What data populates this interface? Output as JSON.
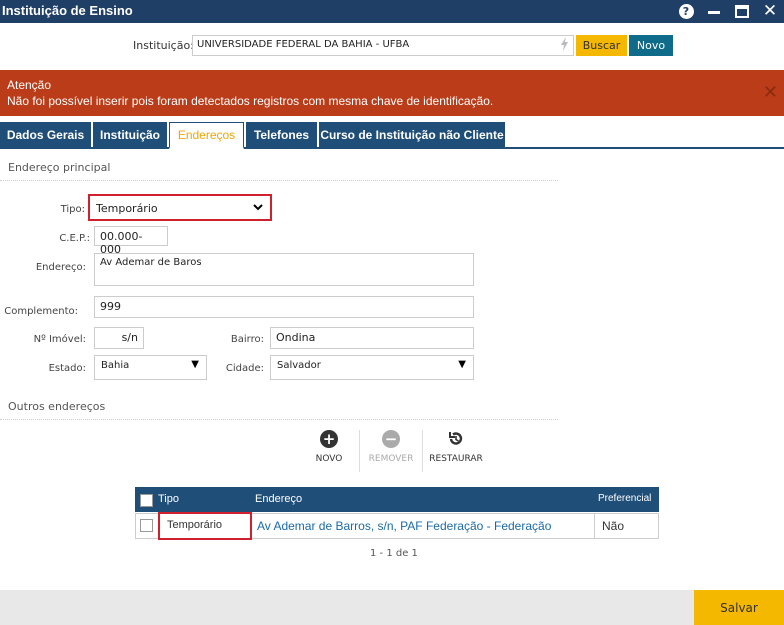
{
  "window": {
    "title": "Instituição de Ensino",
    "help_icon": "help-icon",
    "close_glyph": "✕"
  },
  "search": {
    "label": "Instituição:",
    "value": "UNIVERSIDADE FEDERAL DA BAHIA - UFBA",
    "buscar_label": "Buscar",
    "novo_label": "Novo"
  },
  "alert": {
    "title": "Atenção",
    "message": "Não foi possível inserir pois foram detectados registros com mesma chave de identificação.",
    "close_glyph": "✕",
    "color": "#bb3c18"
  },
  "tabs": [
    {
      "label": "Dados Gerais"
    },
    {
      "label": "Instituição"
    },
    {
      "label": "Endereços",
      "active": true
    },
    {
      "label": "Telefones"
    },
    {
      "label": "Curso de Instituição não Cliente"
    }
  ],
  "address": {
    "section_title": "Endereço principal",
    "tipo_label": "Tipo:",
    "tipo_value": "Temporário",
    "cep_label": "C.E.P.:",
    "cep_value": "00.000-000",
    "endereco_label": "Endereço:",
    "endereco_value": "Av Ademar de Baros",
    "complemento_label": "Complemento:",
    "complemento_value": "999",
    "imovel_label": "Nº Imóvel:",
    "imovel_value": "s/n",
    "bairro_label": "Bairro:",
    "bairro_value": "Ondina",
    "estado_label": "Estado:",
    "estado_value": "Bahia",
    "cidade_label": "Cidade:",
    "cidade_value": "Salvador"
  },
  "others": {
    "section_title": "Outros endereços",
    "toolbar": {
      "novo": "NOVO",
      "remover": "REMOVER",
      "restaurar": "RESTAURAR"
    },
    "table": {
      "headers": [
        "Tipo",
        "Endereço",
        "Preferencial"
      ],
      "rows": [
        {
          "tipo": "Temporário",
          "endereco": "Av Ademar de Barros, s/n, PAF Federação - Federação",
          "preferencial": "Não"
        }
      ]
    },
    "pager": "1 - 1 de 1"
  },
  "footer": {
    "save_label": "Salvar"
  },
  "colors": {
    "titlebar": "#1f3f66",
    "tab": "#1f4e79",
    "accent": "#f5b800",
    "highlight": "#d0202e",
    "link": "#1a6aa8"
  }
}
